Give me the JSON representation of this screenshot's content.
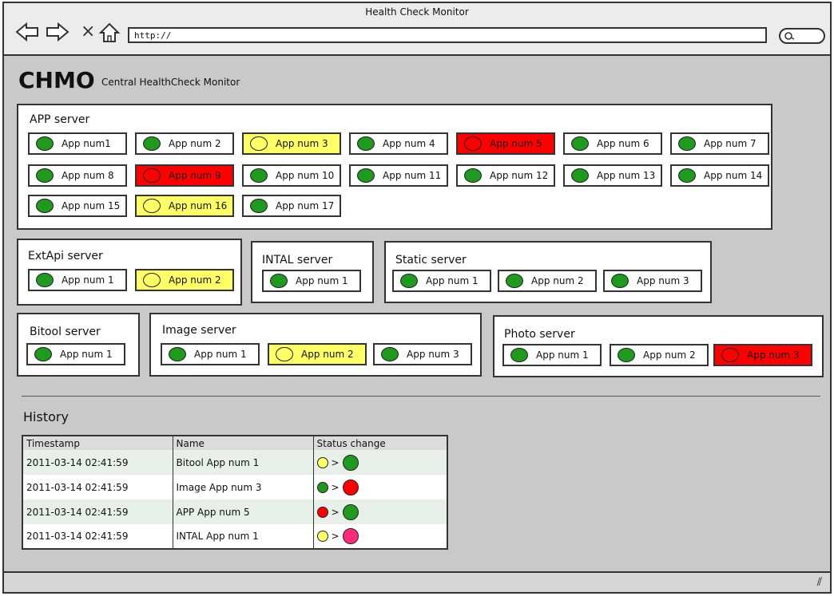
{
  "window": {
    "title": "Health Check Monitor"
  },
  "nav": {
    "back_icon": "arrow-left-icon",
    "forward_icon": "arrow-right-icon",
    "stop": "×",
    "home_icon": "home-icon"
  },
  "address": {
    "value": "http://"
  },
  "header": {
    "title": "CHMO",
    "subtitle": "Central HealthCheck Monitor"
  },
  "colors": {
    "green": "#1f9a1f",
    "yellow": "#ffff66",
    "red": "#ff0000",
    "pink": "#ff2a7a"
  },
  "servers": {
    "app": {
      "title": "APP server",
      "apps": [
        "App num1",
        "App num 2",
        "App num 3",
        "App num 4",
        "App num 5",
        "App num 6",
        "App num 7",
        "App num 8",
        "App num 9",
        "App num 10",
        "App num 11",
        "App num 12",
        "App num 13",
        "App num 14",
        "App num 15",
        "App num 16",
        "App num 17"
      ],
      "status": [
        "green",
        "green",
        "yellow",
        "green",
        "red",
        "green",
        "green",
        "green",
        "red",
        "green",
        "green",
        "green",
        "green",
        "green",
        "green",
        "yellow",
        "green"
      ]
    },
    "extapi": {
      "title": "ExtApi server",
      "apps": [
        "App num 1",
        "App num 2"
      ],
      "status": [
        "green",
        "yellow"
      ]
    },
    "intal": {
      "title": "INTAL server",
      "apps": [
        "App num 1"
      ],
      "status": [
        "green"
      ]
    },
    "static": {
      "title": "Static server",
      "apps": [
        "App num 1",
        "App num 2",
        "App num 3"
      ],
      "status": [
        "green",
        "green",
        "green"
      ]
    },
    "bitool": {
      "title": "Bitool server",
      "apps": [
        "App num 1"
      ],
      "status": [
        "green"
      ]
    },
    "image": {
      "title": "Image server",
      "apps": [
        "App num 1",
        "App num 2",
        "App num 3"
      ],
      "status": [
        "green",
        "yellow",
        "green"
      ]
    },
    "photo": {
      "title": "Photo server",
      "apps": [
        "App num 1",
        "App num 2",
        "App num 3"
      ],
      "status": [
        "green",
        "green",
        "red"
      ]
    }
  },
  "history": {
    "title": "History",
    "columns": [
      "Timestamp",
      "Name",
      "Status change"
    ],
    "rows": [
      {
        "timestamp": "2011-03-14 02:41:59",
        "name": "Bitool App num 1",
        "from": "yellow",
        "to": "green"
      },
      {
        "timestamp": "2011-03-14 02:41:59",
        "name": "Image App num 3",
        "from": "green",
        "to": "red"
      },
      {
        "timestamp": "2011-03-14 02:41:59",
        "name": "APP App num 5",
        "from": "red",
        "to": "green"
      },
      {
        "timestamp": "2011-03-14 02:41:59",
        "name": "INTAL App num 1",
        "from": "yellow",
        "to": "pink"
      }
    ]
  }
}
